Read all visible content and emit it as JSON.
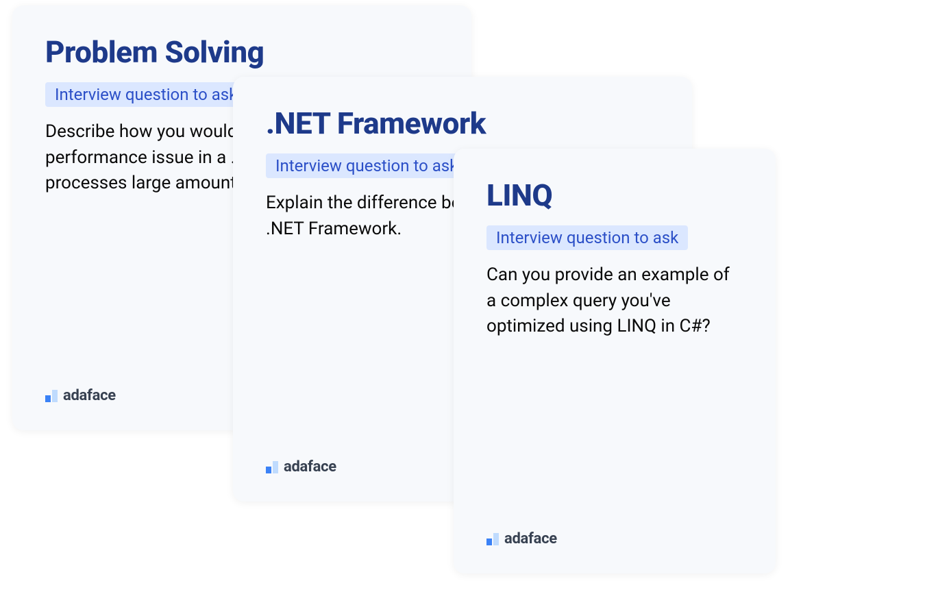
{
  "cards": [
    {
      "title": "Problem Solving",
      "tag": "Interview question to ask",
      "question": "Describe how you would troubleshoot a performance issue in a .NET application that processes large amounts of data."
    },
    {
      "title": ".NET Framework",
      "tag": "Interview question to ask",
      "question": "Explain the difference between .NET Core and .NET Framework."
    },
    {
      "title": "LINQ",
      "tag": "Interview question to ask",
      "question": "Can you provide an example of a complex query you've optimized using LINQ in C#?"
    }
  ],
  "logo": {
    "text": "adaface"
  }
}
